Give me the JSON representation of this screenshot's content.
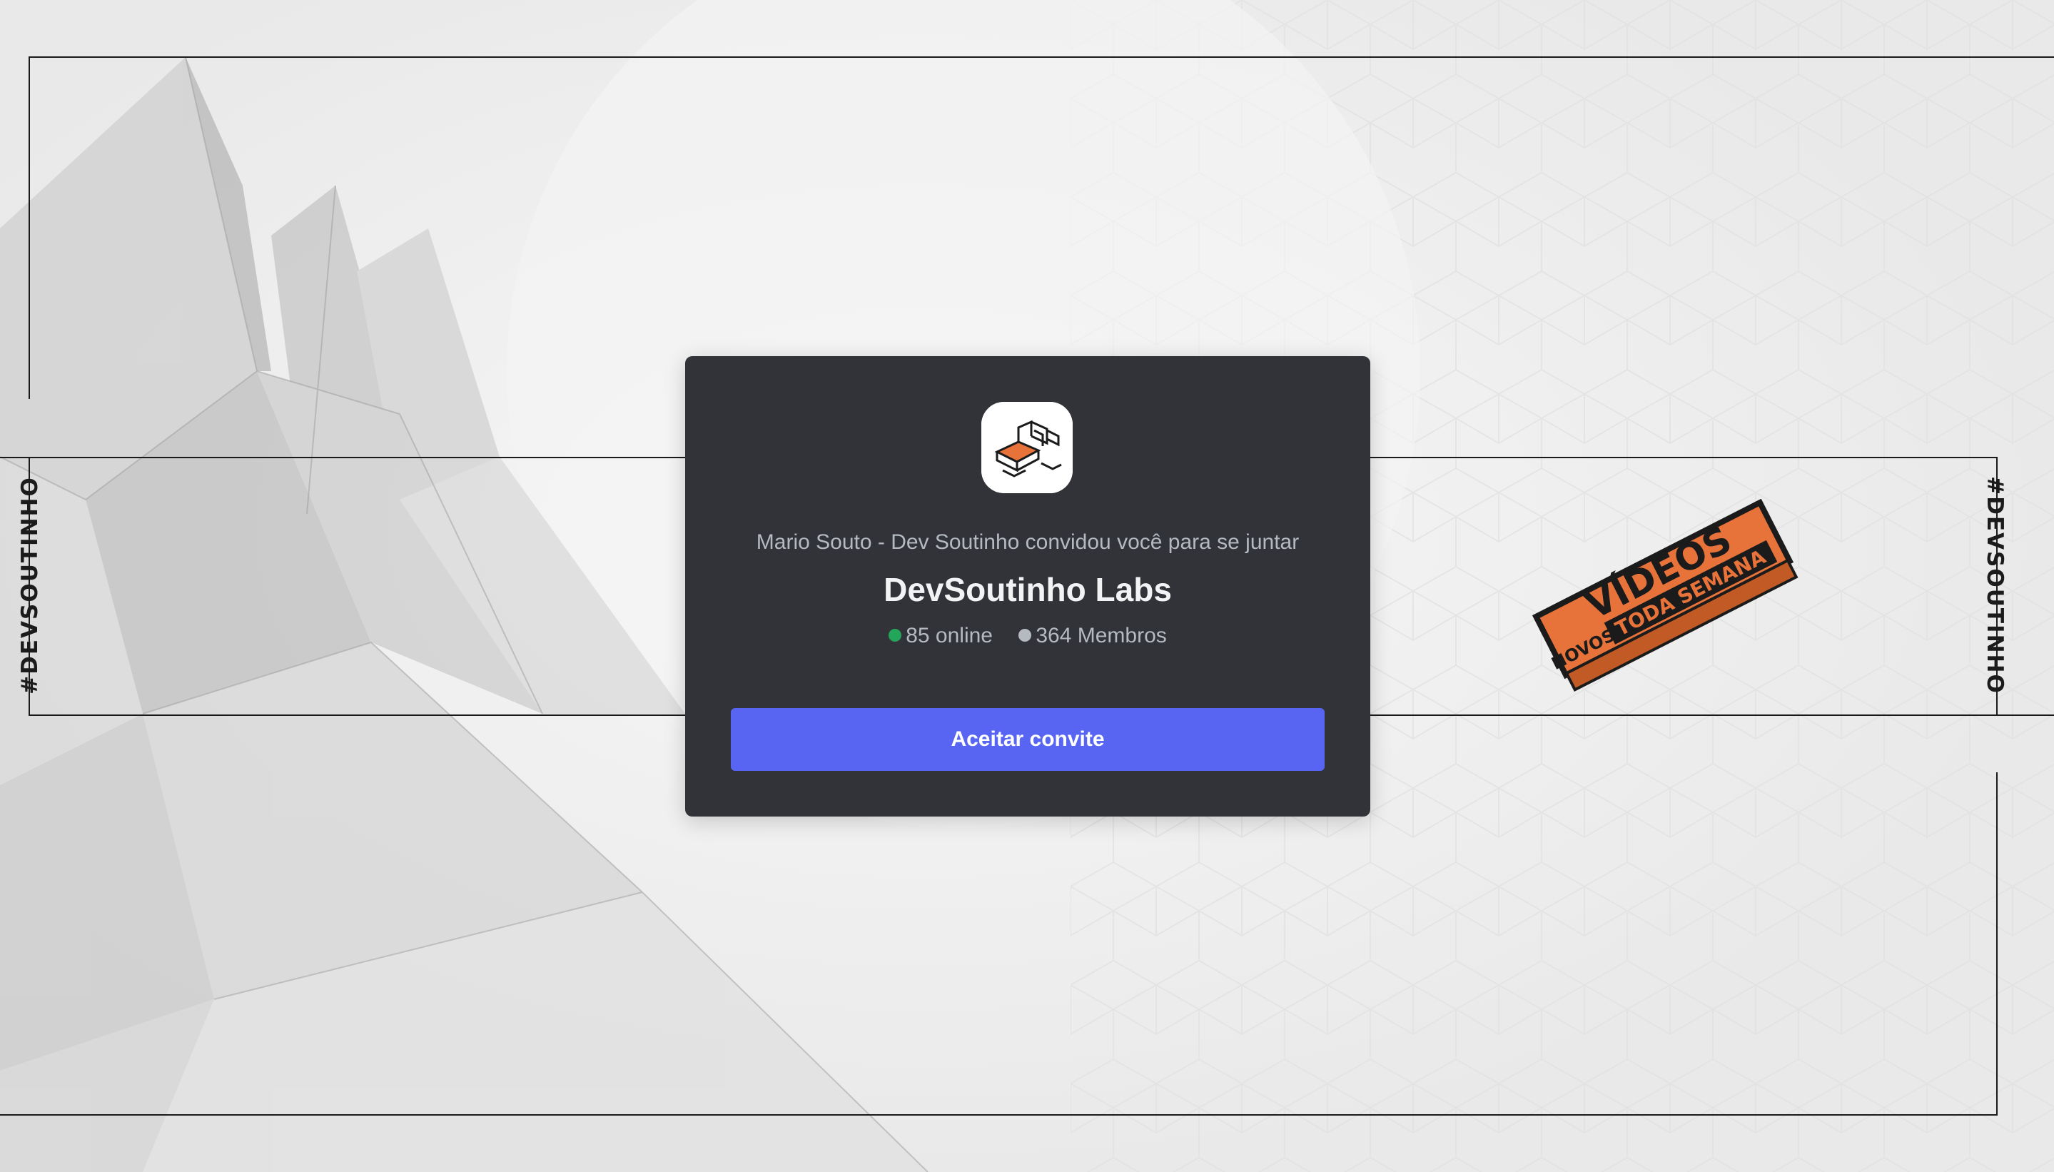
{
  "invite": {
    "inviter_text": "Mario Souto - Dev Soutinho convidou você para se juntar",
    "server_name": "DevSoutinho Labs",
    "online_count": "85 online",
    "member_count": "364 Membros",
    "accept_label": "Aceitar convite"
  },
  "background": {
    "left_tag": "#DEVSOUTINHO",
    "right_tag": "#DEVSOUTINHO",
    "sticker_line1": "VÍDEOS",
    "sticker_line2": "TODA SEMANA",
    "sticker_line3": "NOVOS"
  },
  "colors": {
    "card_bg": "#313338",
    "accept_button": "#5865f2",
    "online_dot": "#23a55a",
    "members_dot": "#b5bac1",
    "sticker_orange": "#e8733a"
  },
  "icons": {
    "server_icon": "devsoutinho-labs-logo",
    "online_indicator": "green-dot",
    "members_indicator": "gray-dot"
  }
}
